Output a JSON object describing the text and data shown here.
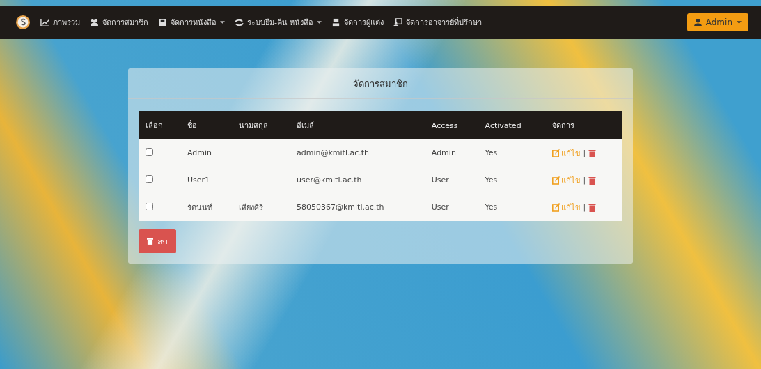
{
  "navbar": {
    "items": [
      {
        "kind": "link",
        "label": "ภาพรวม"
      },
      {
        "kind": "link",
        "label": "จัดการสมาชิก"
      },
      {
        "kind": "dropdown",
        "label": "จัดการหนังสือ"
      },
      {
        "kind": "dropdown",
        "label": "ระบบยืม-คืน หนังสือ"
      },
      {
        "kind": "link",
        "label": "จัดการผู้แต่ง"
      },
      {
        "kind": "link",
        "label": "จัดการอาจารย์ที่ปรึกษา"
      }
    ],
    "user_menu": {
      "label": "Admin"
    }
  },
  "panel": {
    "title": "จัดการสมาชิก",
    "table": {
      "columns": [
        "เลือก",
        "ชื่อ",
        "นามสกุล",
        "อีเมล์",
        "Access",
        "Activated",
        "จัดการ"
      ],
      "rows": [
        {
          "checked": false,
          "first_name": "Admin",
          "email": "admin@kmitl.ac.th",
          "access": "Admin",
          "activated": "Yes",
          "edit": "แก้ไข",
          "separator": "|"
        },
        {
          "checked": false,
          "first_name": "User1",
          "email": "user@kmitl.ac.th",
          "access": "User",
          "activated": "Yes",
          "edit": "แก้ไข",
          "separator": "|"
        },
        {
          "checked": false,
          "first_name": "รัตนนท์",
          "last_name": "เสียงศิริ",
          "email": "58050367@kmitl.ac.th",
          "access": "User",
          "activated": "Yes",
          "edit": "แก้ไข",
          "separator": "|"
        }
      ]
    },
    "delete_button": "ลบ"
  }
}
